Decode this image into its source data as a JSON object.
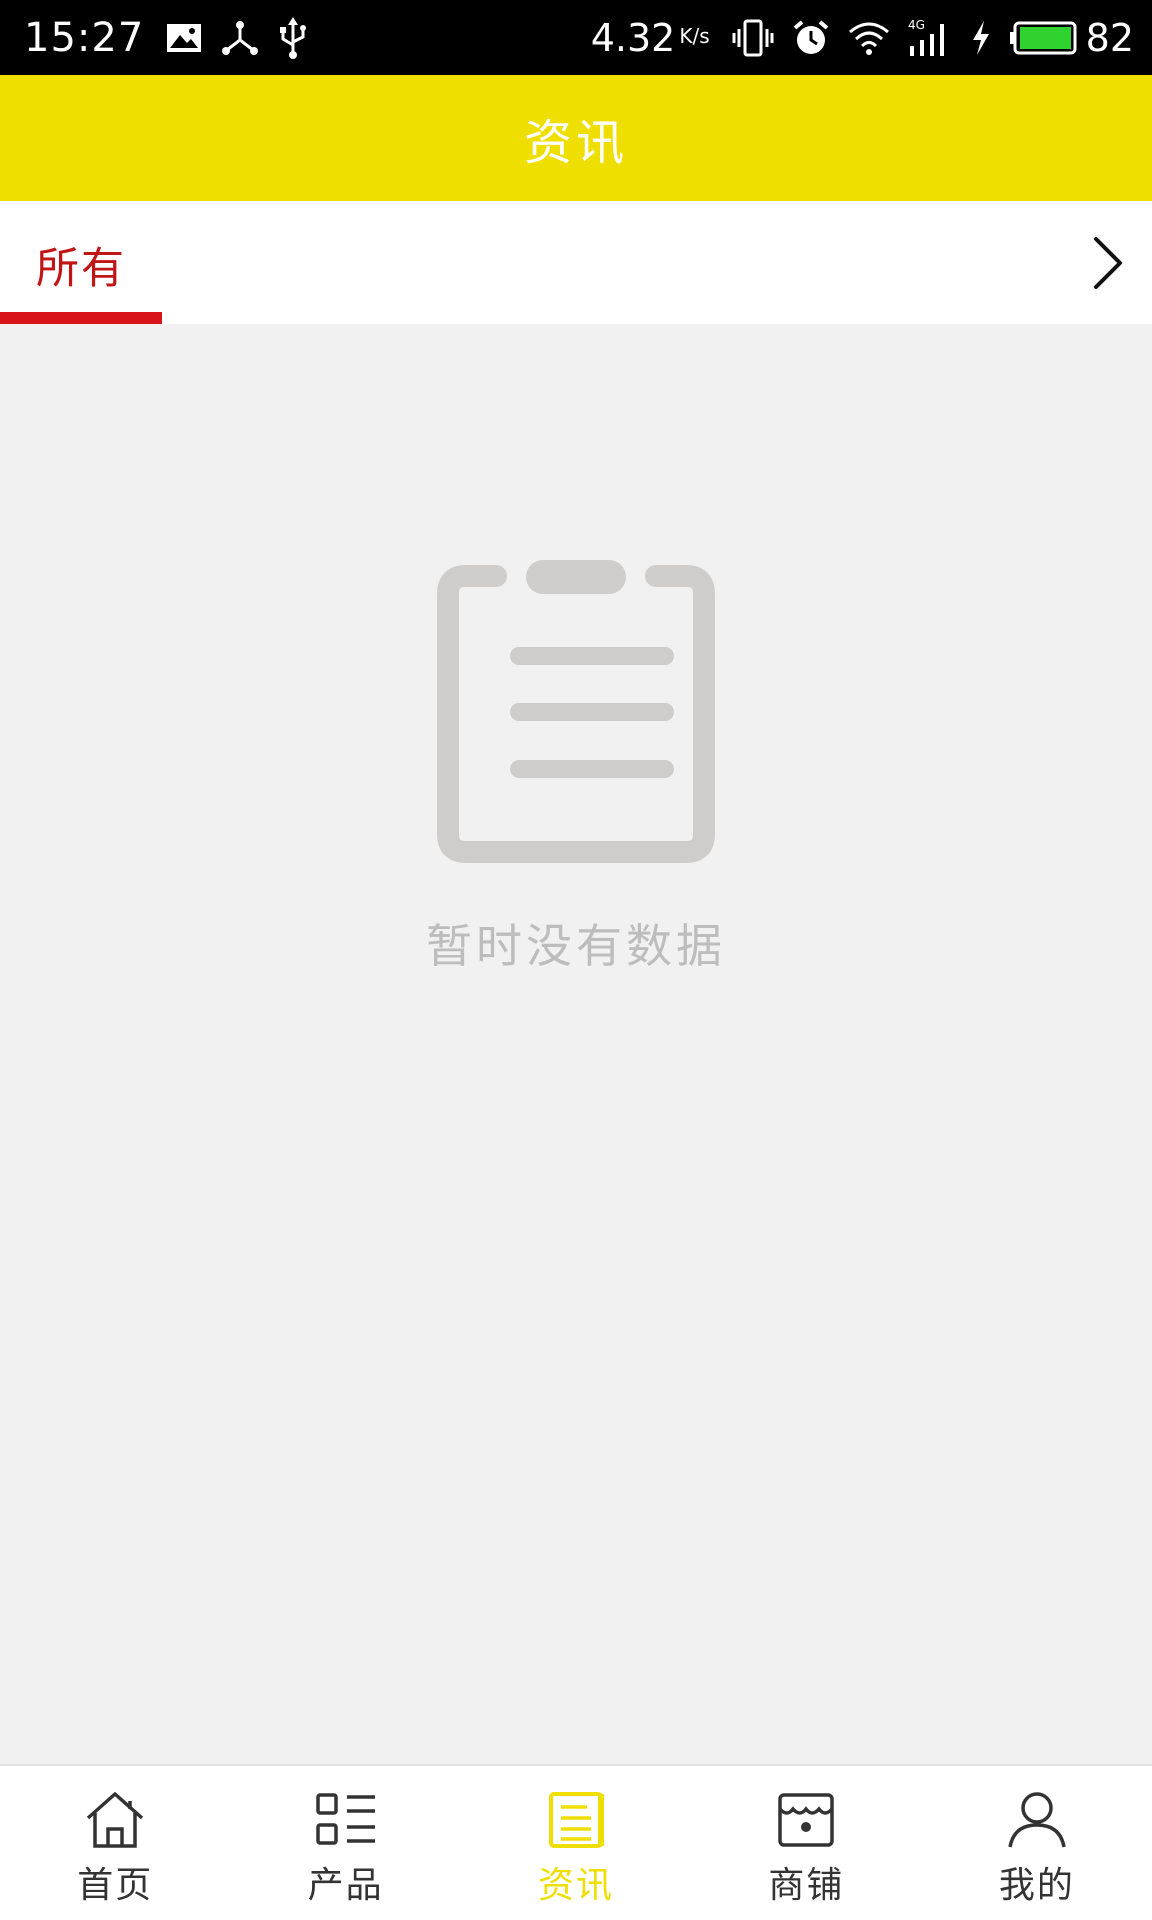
{
  "status_bar": {
    "time": "15:27",
    "net_speed": "4.32",
    "net_speed_unit": "K/s",
    "battery": "82",
    "icons": [
      "image-icon",
      "share-icon",
      "usb-icon",
      "vibrate-icon",
      "alarm-icon",
      "wifi-icon",
      "signal-4g-icon",
      "charging-icon",
      "battery-icon"
    ]
  },
  "header": {
    "title": "资讯"
  },
  "categories": {
    "tabs": [
      {
        "label": "所有",
        "active": true
      }
    ],
    "more_icon": "chevron-right-icon"
  },
  "empty_state": {
    "icon": "clipboard-icon",
    "message": "暂时没有数据"
  },
  "bottom_nav": {
    "items": [
      {
        "label": "首页",
        "icon": "home-icon",
        "active": false
      },
      {
        "label": "产品",
        "icon": "grid-list-icon",
        "active": false
      },
      {
        "label": "资讯",
        "icon": "news-icon",
        "active": true
      },
      {
        "label": "商铺",
        "icon": "store-icon",
        "active": false
      },
      {
        "label": "我的",
        "icon": "user-icon",
        "active": false
      }
    ]
  },
  "colors": {
    "brand_yellow": "#efdf00",
    "accent_red": "#d8141a",
    "empty_gray": "#cfcccc"
  }
}
